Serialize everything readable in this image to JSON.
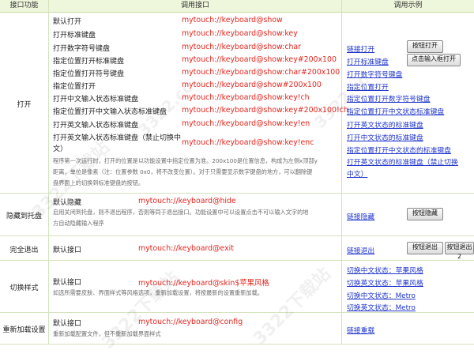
{
  "headers": {
    "feature": "接口功能",
    "api": "调用接口",
    "example": "调用示例"
  },
  "open": {
    "feature": "打开",
    "rows": [
      {
        "label": "默认打开",
        "code": "mytouch://keyboard@show"
      },
      {
        "label": "打开标准键盘",
        "code": "mytouch://keyboard@show:key"
      },
      {
        "label": "打开数字符号键盘",
        "code": "mytouch://keyboard@show:char"
      },
      {
        "label": "指定位置打开标准键盘",
        "code": "mytouch://keyboard@show:key#200x100"
      },
      {
        "label": "指定位置打开符号键盘",
        "code": "mytouch://keyboard@show:char#200x100"
      },
      {
        "label": "指定位置打开",
        "code": "mytouch://keyboard@show#200x100"
      },
      {
        "label": "打开中文输入状态标准键盘",
        "code": "mytouch://keyboard@show:key!ch"
      },
      {
        "label": "指定位置打开中文输入状态标准键盘",
        "code": "mytouch://keyboard@show:key#200x100!ch"
      },
      {
        "label": "打开英文输入状态标准键盘",
        "code": "mytouch://keyboard@show:key!en"
      },
      {
        "label": "打开英文输入状态标准键盘（禁止切换中文）",
        "label_line1": "打开英文输入状态标准键盘（禁止切换中",
        "label_line2": "文）",
        "code": "mytouch://keyboard@show:key!enc"
      }
    ],
    "note_lines": [
      "程序第一次运行时，打开的位置是以功能设置中指定位置为准。200x100是位置信息，构成为左侧x顶部y",
      "距离，单位是像素（注：位置参数 0x0，将不改变位置）。对于只需要显示数字键盘的地方，可以翻除键",
      "盘界面上的切换到标准键盘的按钮。"
    ],
    "links": [
      "链接打开",
      "打开标准键盘",
      "打开数字符号键盘",
      "指定位置打开",
      "指定位置打开数字符号键盘",
      "指定位置打开中文状态标准键盘",
      "打开英文状态的标准键盘",
      "打开中文状态的标准键盘",
      "指定位置打开中文状态的标准键盘",
      "打开英文状态的标准键盘（禁止切换",
      "中文）"
    ],
    "buttons": {
      "open": "按钮打开",
      "click_input": "点击输入框打开"
    }
  },
  "hide": {
    "feature": "隐藏到托盘",
    "label": "默认隐藏",
    "code": "mytouch://keyboard@hide",
    "note_lines": [
      "启用关闭到托盘，则不退出程序，否则等同于退出接口。功能设置中可以设置点击不可以输入文字的地",
      "方自动隐藏输入程序"
    ],
    "link": "链接隐藏",
    "button": "按钮隐藏"
  },
  "exit": {
    "feature": "完全退出",
    "label": "默认接口",
    "code": "mytouch://keyboard@exit",
    "link": "链接退出",
    "button1": "按钮退出",
    "button2": "按钮退出2"
  },
  "skin": {
    "feature": "切换样式",
    "label": "默认接口",
    "code": "mytouch://keyboard@skin$苹果风格",
    "note": "如选所需要皮肤、界面样式等风格选项，重新加载设置，将按最新的设置重新加载。",
    "links": [
      "切换中文状态：苹果风格",
      "切换英文状态：苹果风格",
      "切换中文状态：Metro",
      "切换英文状态：Metro"
    ]
  },
  "reload": {
    "feature": "重新加载设置",
    "label": "默认接口",
    "code": "mytouch://keyboard@config",
    "note": "重新加载配置文件，但不重新加载界面样式",
    "link": "链接重载"
  },
  "watermarks": [
    "3322下载站",
    "3322下载站",
    "3322下载站",
    "3322.cc",
    "3322.cc"
  ]
}
